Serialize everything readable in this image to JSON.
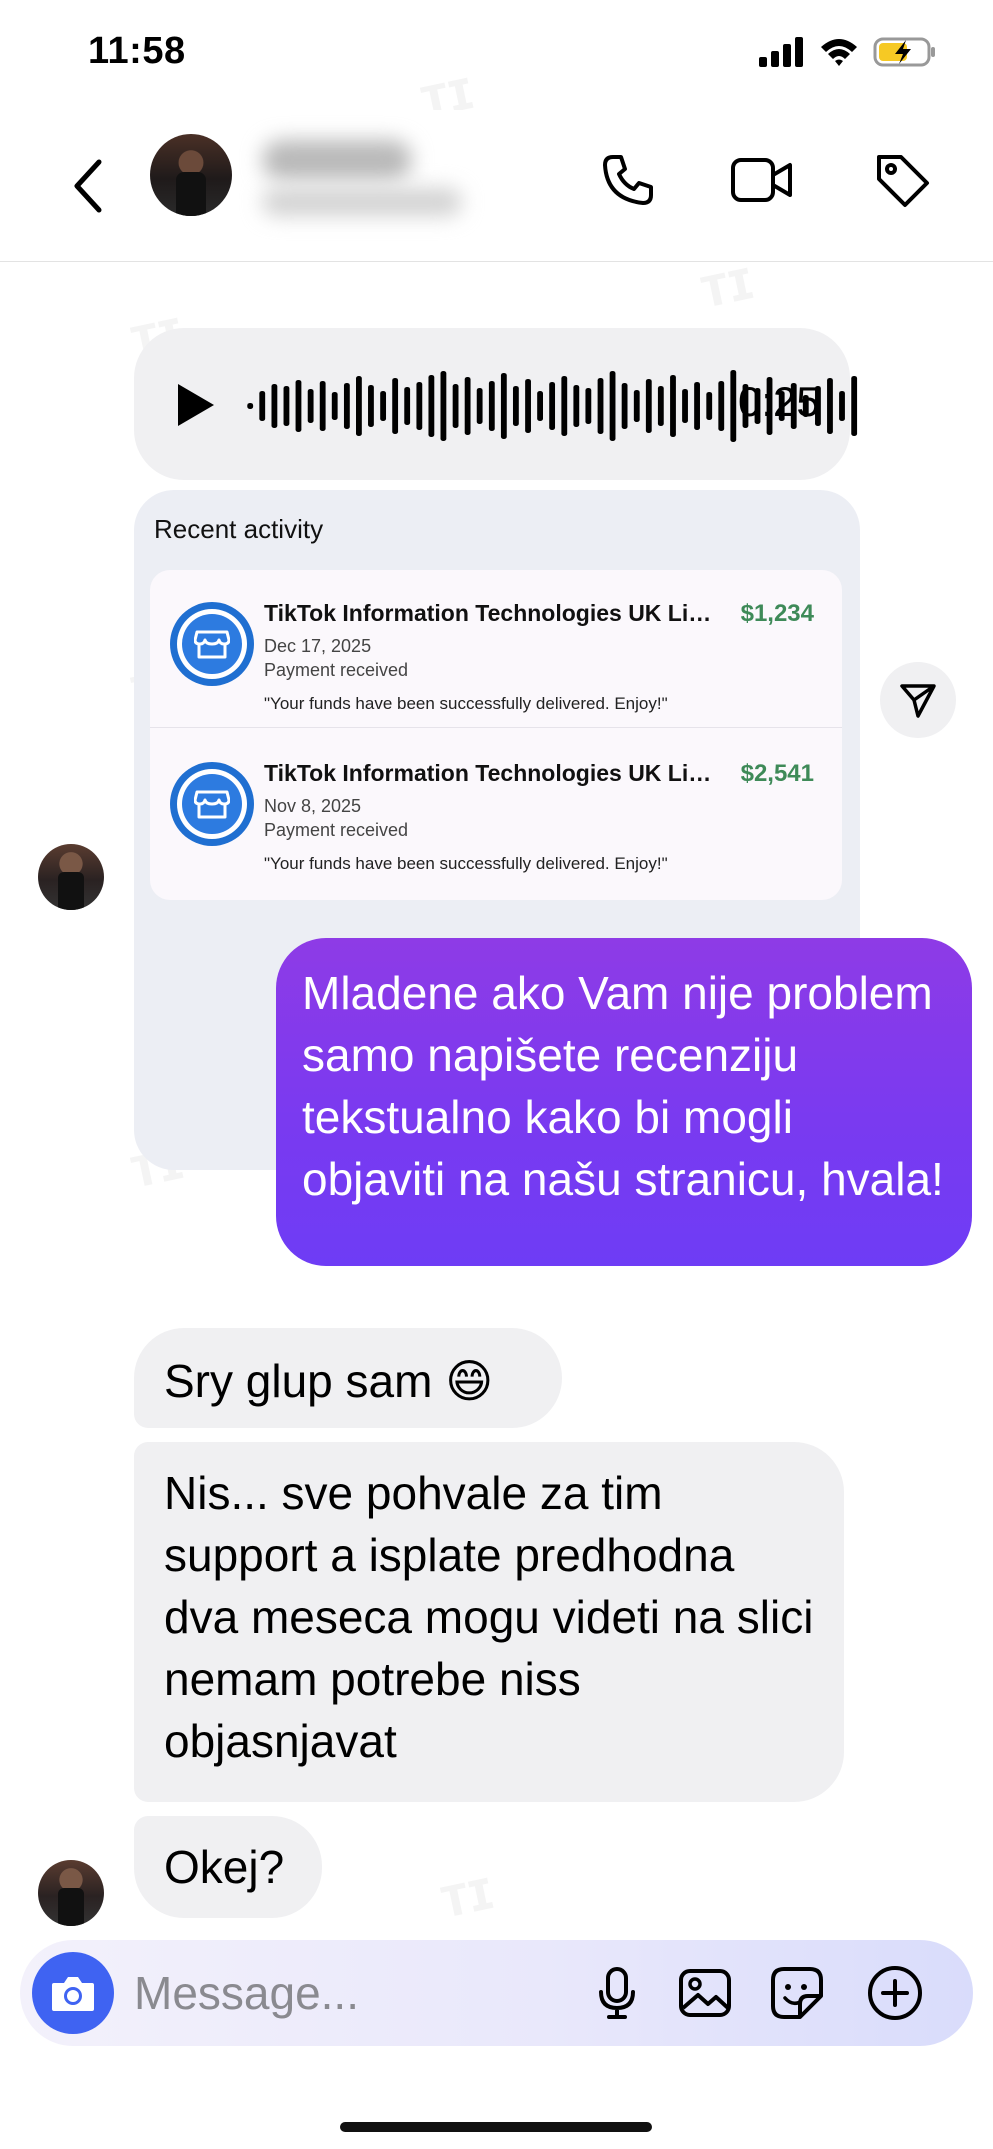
{
  "status_bar": {
    "time": "11:58"
  },
  "header": {
    "back_icon": "chevron-left-icon",
    "call_icon": "phone-icon",
    "video_icon": "video-camera-icon",
    "tag_icon": "tag-icon"
  },
  "voice_message": {
    "duration": "0:25"
  },
  "recent_activity": {
    "title": "Recent activity",
    "transactions": [
      {
        "merchant": "TikTok Information Technologies UK Limi...",
        "amount": "$1,234",
        "date": "Dec 17, 2025",
        "status": "Payment received",
        "note": "\"Your funds have been successfully delivered. Enjoy!\""
      },
      {
        "merchant": "TikTok Information Technologies UK Limi...",
        "amount": "$2,541",
        "date": "Nov 8, 2025",
        "status": "Payment received",
        "note": "\"Your funds have been successfully delivered. Enjoy!\""
      }
    ]
  },
  "messages": [
    {
      "direction": "out",
      "text": "Mladene ako Vam nije problem samo napišete recenziju tekstualno kako bi mogli objaviti na našu stranicu, hvala!"
    },
    {
      "direction": "in",
      "text": "Sry glup sam 😄"
    },
    {
      "direction": "in",
      "text": "Nis... sve pohvale za tim support a isplate predhodna dva meseca mogu videti na slici nemam potrebe niss objasnjavat"
    },
    {
      "direction": "in",
      "text": "Okej?"
    }
  ],
  "composer": {
    "placeholder": "Message...",
    "icons": [
      "camera-icon",
      "microphone-icon",
      "gallery-icon",
      "sticker-icon",
      "plus-circle-icon"
    ]
  },
  "colors": {
    "outgoing_bubble": "#7a3af0",
    "incoming_bubble": "#f0f0f2",
    "camera_button": "#3f63f2",
    "amount_green": "#3e8a58"
  }
}
